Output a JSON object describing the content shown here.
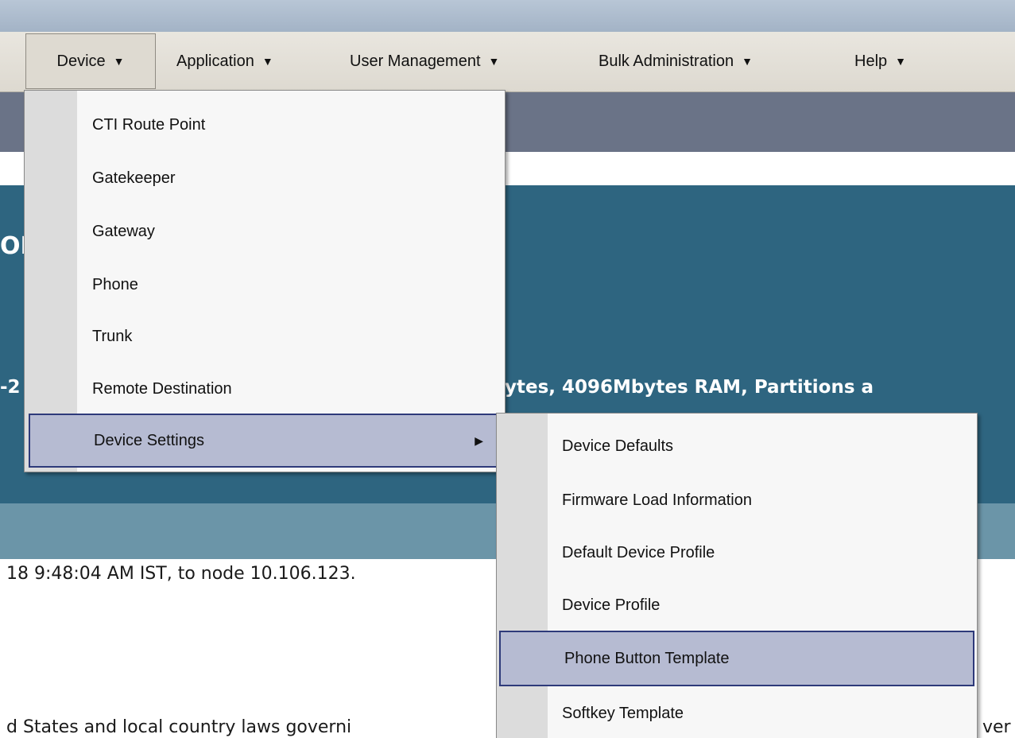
{
  "menubar": {
    "items": [
      {
        "label": "Device",
        "caret": "▼"
      },
      {
        "label": "Application",
        "caret": "▼"
      },
      {
        "label": "User Management",
        "caret": "▼"
      },
      {
        "label": "Bulk Administration",
        "caret": "▼"
      },
      {
        "label": "Help",
        "caret": "▼"
      }
    ]
  },
  "device_menu": {
    "items": [
      {
        "label": "CTI Route Point"
      },
      {
        "label": "Gatekeeper"
      },
      {
        "label": "Gateway"
      },
      {
        "label": "Phone"
      },
      {
        "label": "Trunk"
      },
      {
        "label": "Remote Destination"
      },
      {
        "label": "Device Settings",
        "highlighted": true
      }
    ],
    "submenu_arrow": "▶"
  },
  "device_settings_menu": {
    "items": [
      {
        "label": "Device Defaults"
      },
      {
        "label": "Firmware Load Information"
      },
      {
        "label": "Default Device Profile"
      },
      {
        "label": "Device Profile"
      },
      {
        "label": "Phone Button Template",
        "highlighted": true
      },
      {
        "label": "Softkey Template"
      }
    ]
  },
  "background": {
    "blue_panel_fragment_1": "OI",
    "blue_panel_fragment_2": "-2",
    "system_info_fragment": "ytes, 4096Mbytes RAM, Partitions a",
    "login_fragment": "18 9:48:04 AM IST, to node 10.106.123.",
    "legal_fragment_left": "d States and local country laws governi",
    "legal_fragment_right": "ver"
  },
  "colors": {
    "panel_blue": "#2e6580",
    "slate_band": "#6a7387",
    "highlight": "#b6bbd2",
    "highlight_border": "#2e3a7a"
  }
}
